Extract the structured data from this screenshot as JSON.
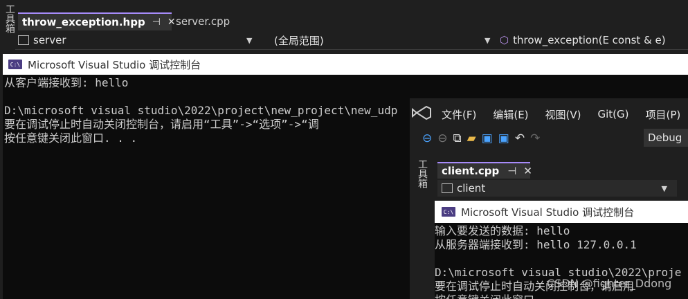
{
  "left_strip": {
    "label": "工具箱"
  },
  "tabs": [
    {
      "label": "throw_exception.hpp",
      "active": true
    },
    {
      "label": "server.cpp",
      "active": false
    }
  ],
  "navbar": {
    "project": "server",
    "scope": "(全局范围)",
    "member": "throw_exception(E const & e)"
  },
  "console1": {
    "title": "Microsoft Visual Studio 调试控制台",
    "lines": [
      "从客户端接收到: hello",
      "",
      "D:\\microsoft visual studio\\2022\\project\\new_project\\new_udp",
      "要在调试停止时自动关闭控制台，请启用“工具”->“选项”->“调",
      "按任意键关闭此窗口. . ."
    ]
  },
  "overlay": {
    "menu": [
      "文件(F)",
      "编辑(E)",
      "视图(V)",
      "Git(G)",
      "项目(P)"
    ],
    "config": "Debug",
    "left_strip_label": "工具箱",
    "tab": {
      "label": "client.cpp"
    },
    "project": "client",
    "console2": {
      "title": "Microsoft Visual Studio 调试控制台",
      "lines": [
        "输入要发送的数据: hello",
        "从服务器端接收到: hello 127.0.0.1",
        "",
        "D:\\microsoft visual studio\\2022\\proje",
        "要在调试停止时自动关闭控制台，请启用",
        "按任意键关闭此窗口. . ."
      ]
    }
  },
  "watermark": "CSDN @fighter_Ddong",
  "colors": {
    "accent": "#a78bfa",
    "console_bg": "#0c0c0c",
    "ide_bg": "#1f1f1f",
    "console_icon": "#4b3d82"
  }
}
